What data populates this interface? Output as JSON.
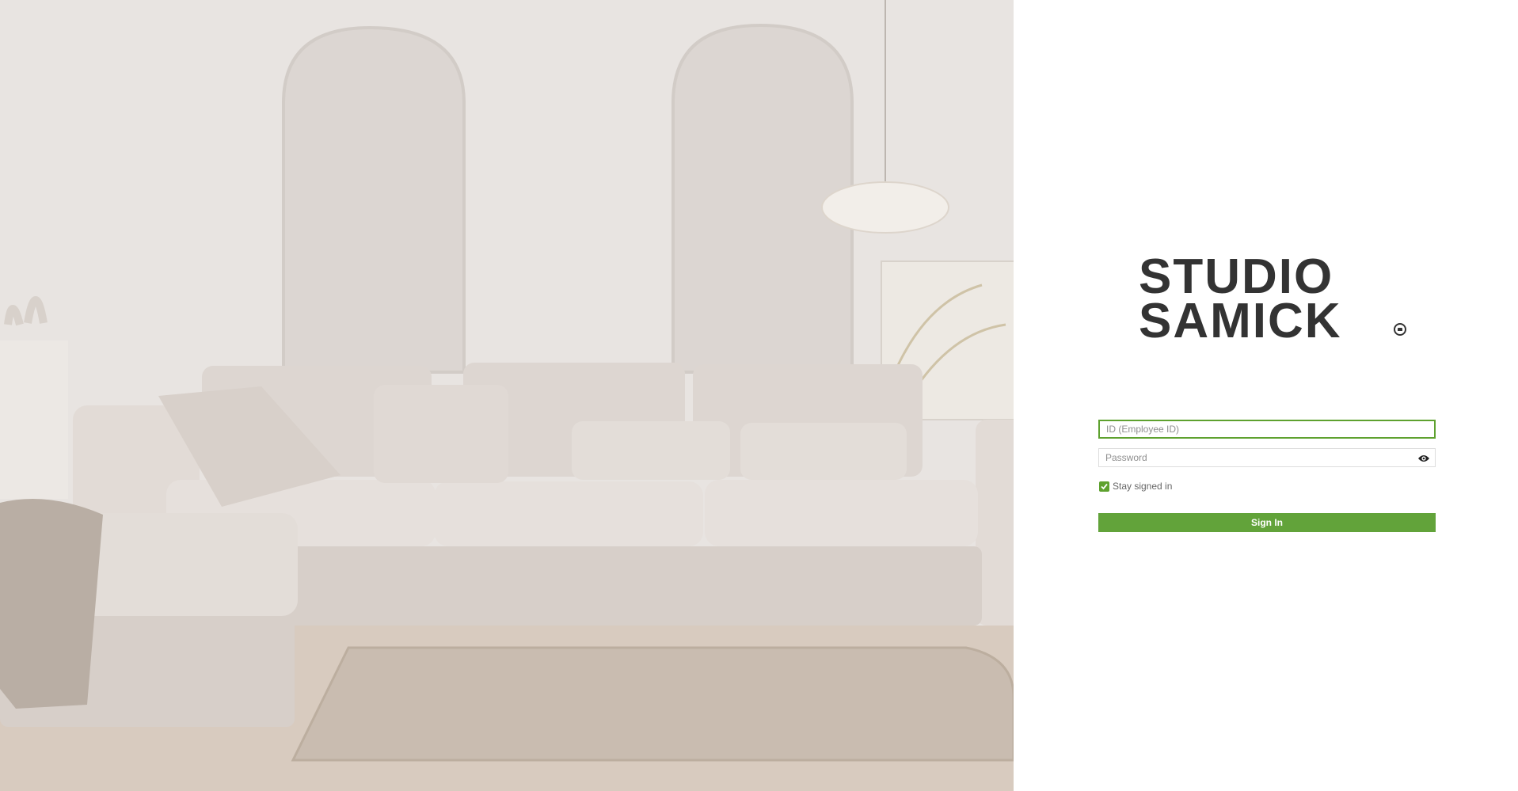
{
  "brand": {
    "logo_line_1": "STUDIO",
    "logo_line_2": "SAMICK"
  },
  "login": {
    "id_placeholder": "ID (Employee ID)",
    "id_value": "",
    "password_placeholder": "Password",
    "password_value": "",
    "stay_signed_in_label": "Stay signed in",
    "stay_signed_in_checked": true,
    "sign_in_label": "Sign In"
  },
  "icons": {
    "password_toggle": "eye-icon",
    "checkbox_mark": "check-icon",
    "logo_mark": "sofa-badge-icon"
  },
  "colors": {
    "accent_green": "#62a33a",
    "focus_border": "#5ea12f",
    "logo_text": "#333333"
  }
}
